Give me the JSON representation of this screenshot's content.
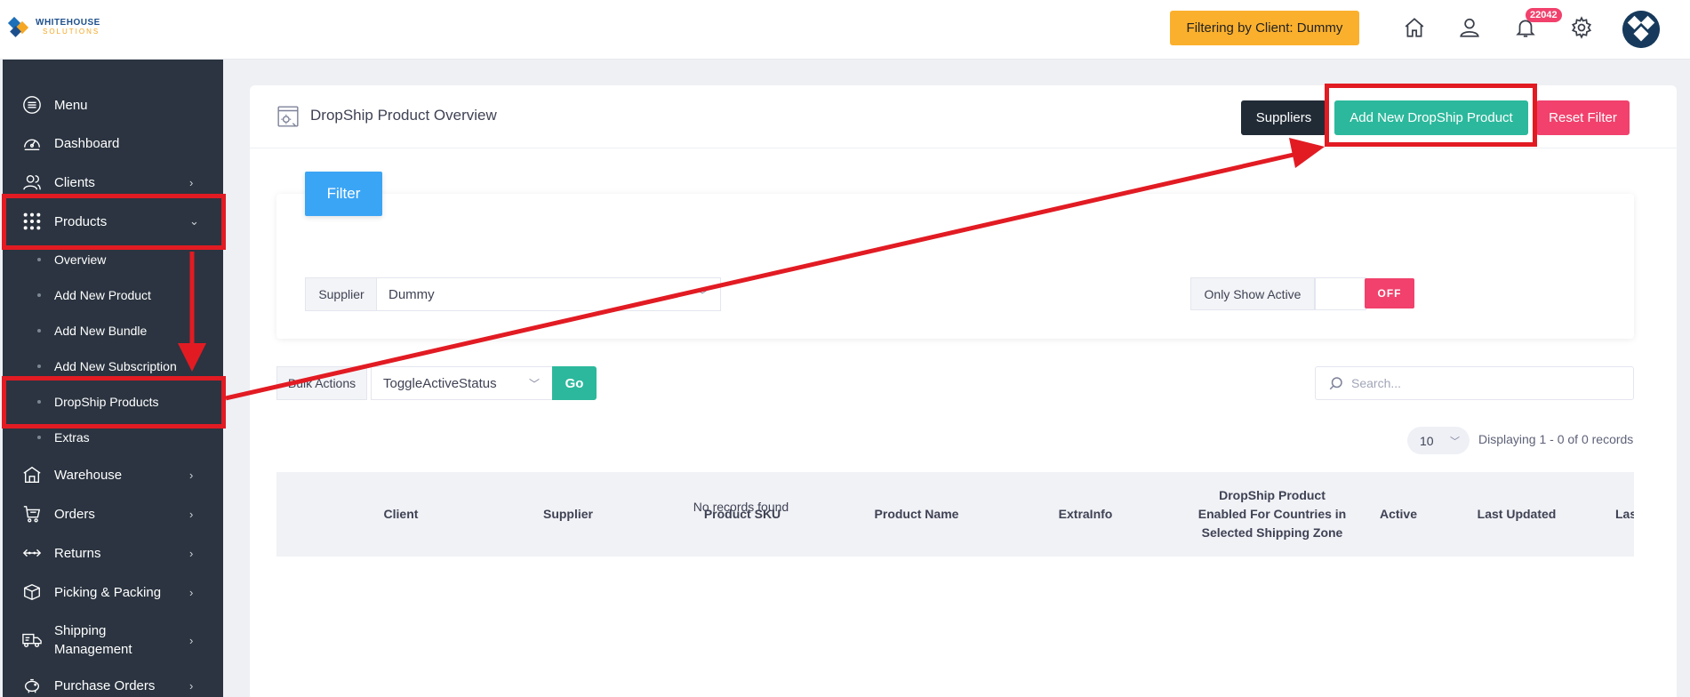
{
  "header": {
    "logo_line1": "WHITEHOUSE",
    "logo_line2": "SOLUTIONS",
    "filter_badge": "Filtering by Client: Dummy",
    "notification_count": "22042"
  },
  "sidebar": {
    "items": [
      {
        "label": "Menu",
        "icon": "menu-icon"
      },
      {
        "label": "Dashboard",
        "icon": "dashboard-icon"
      },
      {
        "label": "Clients",
        "icon": "users-icon"
      },
      {
        "label": "Products",
        "icon": "grid-icon"
      }
    ],
    "sub_items": [
      "Overview",
      "Add New Product",
      "Add New Bundle",
      "Add New Subscription",
      "DropShip Products",
      "Extras"
    ],
    "items_after": [
      {
        "label": "Warehouse",
        "icon": "warehouse-icon"
      },
      {
        "label": "Orders",
        "icon": "cart-icon"
      },
      {
        "label": "Returns",
        "icon": "returns-icon"
      },
      {
        "label": "Picking & Packing",
        "icon": "box-icon"
      },
      {
        "label": "Shipping",
        "label2": "Management",
        "icon": "truck-icon"
      },
      {
        "label": "Purchase Orders",
        "icon": "piggy-bank-icon"
      }
    ]
  },
  "main": {
    "title": "DropShip Product Overview",
    "buttons": {
      "suppliers": "Suppliers",
      "add_new": "Add New DropShip Product",
      "reset": "Reset Filter"
    },
    "filter_tab": "Filter",
    "supplier_label": "Supplier",
    "supplier_value": "Dummy",
    "only_active_label": "Only Show Active",
    "toggle_state": "OFF",
    "bulk_label": "Bulk Actions",
    "bulk_value": "ToggleActiveStatus",
    "go": "Go",
    "search_placeholder": "Search...",
    "per_page": "10",
    "records_text": "Displaying 1 - 0 of 0 records",
    "columns": [
      "Client",
      "Supplier",
      "Product SKU",
      "Product Name",
      "ExtraInfo",
      "DropShip Product",
      "Enabled For Countries in",
      "Selected Shipping Zone",
      "Active",
      "Last Updated",
      "Las"
    ],
    "empty_text": "No records found"
  },
  "colors": {
    "sidebar_bg": "#2b3440",
    "accent_teal": "#2cb89c",
    "accent_pink": "#f1416c",
    "badge_orange": "#fbb02d",
    "filter_blue": "#3ba5f5",
    "annotation_red": "#e21b23"
  }
}
